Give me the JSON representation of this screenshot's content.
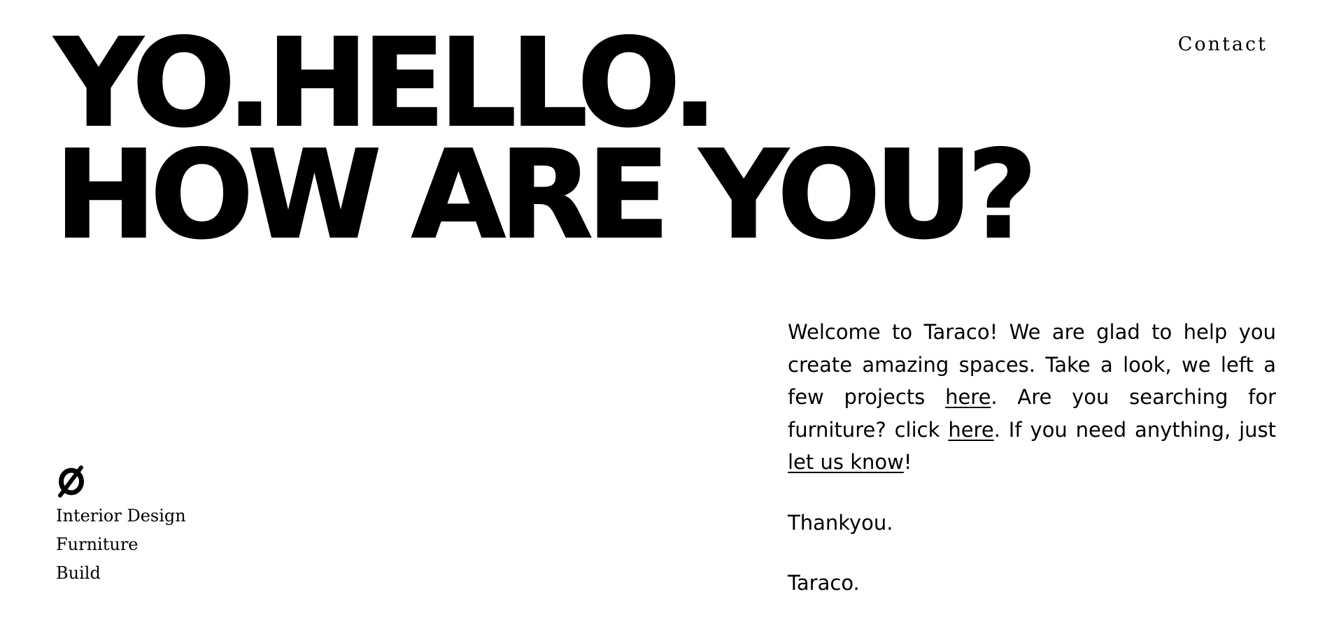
{
  "hero": {
    "line1": "YO.HELLO.",
    "line2": "HOW ARE YOU?"
  },
  "nav": {
    "contact": "Contact"
  },
  "intro": {
    "part1": "Welcome to Taraco! We are glad to help you create amazing spaces. Take a look, we left a few projects ",
    "link1": "here",
    "part2": ". Are you searching for furniture? click ",
    "link2": "here",
    "part3": ". If you need anything, just ",
    "link3": "let us know",
    "part4": "!",
    "thanks": "Thankyou.",
    "signature": "Taraco."
  },
  "brand": {
    "logo_icon": "slashed-circle-logo-icon",
    "services": [
      "Interior Design",
      "Furniture",
      "Build"
    ]
  }
}
